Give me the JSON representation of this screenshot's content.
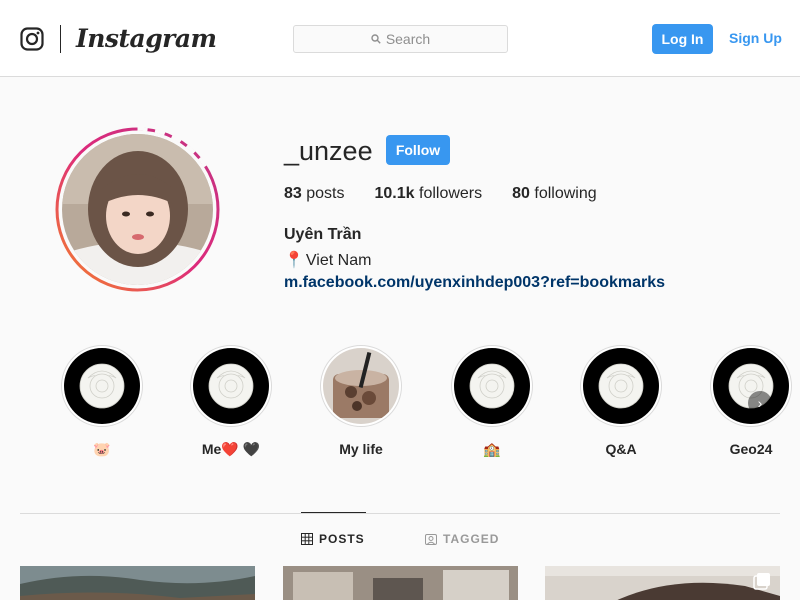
{
  "nav": {
    "brand": "Instagram",
    "search_placeholder": "Search",
    "login_label": "Log In",
    "signup_label": "Sign Up"
  },
  "profile": {
    "username": "_unzee",
    "follow_label": "Follow",
    "stats": {
      "posts_count": "83",
      "posts_label": "posts",
      "followers_count": "10.1k",
      "followers_label": "followers",
      "following_count": "80",
      "following_label": "following"
    },
    "full_name": "Uyên Trần",
    "location": "Viet Nam",
    "location_icon": "pin-icon",
    "website": "m.facebook.com/uyenxinhdep003?ref=bookmarks"
  },
  "highlights": [
    {
      "label": "🐷"
    },
    {
      "label_text": "Me",
      "label_hearts": "❤️ 🖤"
    },
    {
      "label": "My life"
    },
    {
      "label": "🏫"
    },
    {
      "label": "Q&A"
    },
    {
      "label": "Geo24"
    }
  ],
  "tabs": {
    "posts": "POSTS",
    "tagged": "TAGGED"
  },
  "colors": {
    "accent": "#3897f0",
    "link": "#003569",
    "border": "#dbdbdb",
    "background": "#fafafa"
  }
}
